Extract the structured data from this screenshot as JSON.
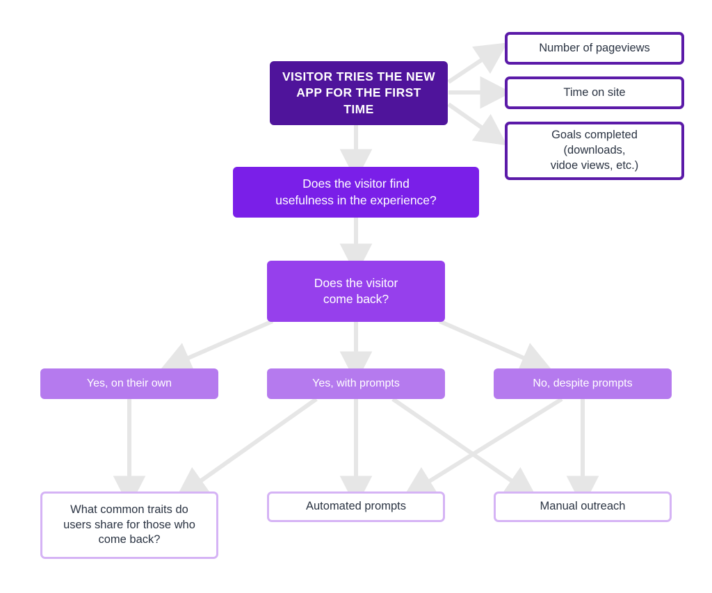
{
  "diagram": {
    "title": "Visitor engagement decision flowchart",
    "colors": {
      "root_fill": "#4F149B",
      "decision1_fill": "#7A1FE8",
      "decision2_fill": "#9640EC",
      "pill_fill": "#B57AEE",
      "metric_border": "#5B1AA8",
      "action_border": "#D5B3F5",
      "arrow": "#E8E8E8",
      "body_text": "#2A3342",
      "node_text": "#FFFFFF",
      "background": "#FFFFFF"
    },
    "nodes": {
      "root": {
        "label": "Visitor tries the new\napp for the first time"
      },
      "metrics": [
        {
          "label": "Number of pageviews"
        },
        {
          "label": "Time on site"
        },
        {
          "label": "Goals completed\n(downloads,\nvidoe views, etc.)"
        }
      ],
      "decision_usefulness": {
        "label": "Does the visitor find\nusefulness in the experience?"
      },
      "decision_comeback": {
        "label": "Does the visitor\ncome back?"
      },
      "outcomes": [
        {
          "label": "Yes, on their own"
        },
        {
          "label": "Yes, with prompts"
        },
        {
          "label": "No, despite prompts"
        }
      ],
      "actions": [
        {
          "label": "What common traits do\nusers share for those who\ncome back?"
        },
        {
          "label": "Automated prompts"
        },
        {
          "label": "Manual outreach"
        }
      ]
    },
    "edges": [
      {
        "from": "root",
        "to": "metric-pageviews"
      },
      {
        "from": "root",
        "to": "metric-time-on-site"
      },
      {
        "from": "root",
        "to": "metric-goals-completed"
      },
      {
        "from": "root",
        "to": "decision-usefulness"
      },
      {
        "from": "decision-usefulness",
        "to": "decision-comeback"
      },
      {
        "from": "decision-comeback",
        "to": "outcome-yes-own"
      },
      {
        "from": "decision-comeback",
        "to": "outcome-yes-prompts"
      },
      {
        "from": "decision-comeback",
        "to": "outcome-no-prompts"
      },
      {
        "from": "outcome-yes-own",
        "to": "action-common-traits"
      },
      {
        "from": "outcome-yes-prompts",
        "to": "action-common-traits"
      },
      {
        "from": "outcome-yes-prompts",
        "to": "action-automated-prompts"
      },
      {
        "from": "outcome-yes-prompts",
        "to": "action-manual-outreach"
      },
      {
        "from": "outcome-no-prompts",
        "to": "action-automated-prompts"
      },
      {
        "from": "outcome-no-prompts",
        "to": "action-manual-outreach"
      }
    ]
  }
}
